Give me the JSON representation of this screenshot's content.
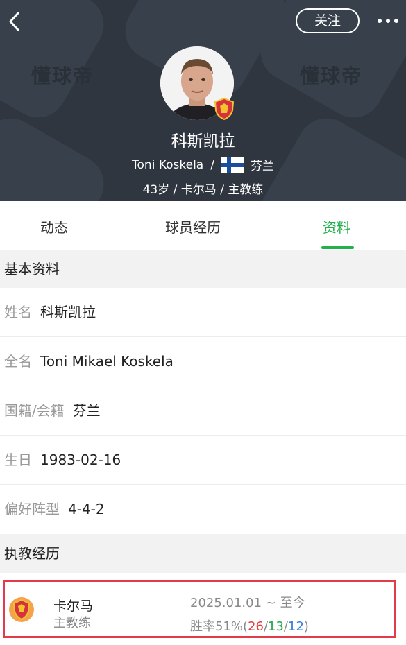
{
  "header": {
    "back_icon": "chevron-left-icon",
    "follow_label": "关注",
    "more_icon": "more-dots-icon",
    "watermark": "懂球帝",
    "player_name": "科斯凯拉",
    "english_name": "Toni Koskela",
    "separator": "/",
    "nationality": "芬兰",
    "info": "43岁 / 卡尔马 / 主教练",
    "colors": {
      "background": "#2f3640"
    }
  },
  "tabs": [
    {
      "label": "动态",
      "active": false
    },
    {
      "label": "球员经历",
      "active": false
    },
    {
      "label": "资料",
      "active": true
    }
  ],
  "basic_info": {
    "title": "基本资料",
    "rows": [
      {
        "label": "姓名",
        "value": "科斯凯拉"
      },
      {
        "label": "全名",
        "value": "Toni Mikael Koskela"
      },
      {
        "label": "国籍/会籍",
        "value": "芬兰"
      },
      {
        "label": "生日",
        "value": "1983-02-16"
      },
      {
        "label": "偏好阵型",
        "value": "4-4-2"
      }
    ]
  },
  "coaching": {
    "title": "执教经历",
    "items": [
      {
        "club": "卡尔马",
        "role": "主教练",
        "period": "2025.01.01 ~ 至今",
        "winrate_prefix": "胜率51%(",
        "wins": "26",
        "draws": "13",
        "losses": "12",
        "slash": "/",
        "close": ")"
      }
    ]
  },
  "colors": {
    "accent": "#22b14c",
    "highlight_border": "#e23b4b",
    "win": "#e23b3b",
    "draw": "#22a84a",
    "loss": "#3a7bd5"
  }
}
